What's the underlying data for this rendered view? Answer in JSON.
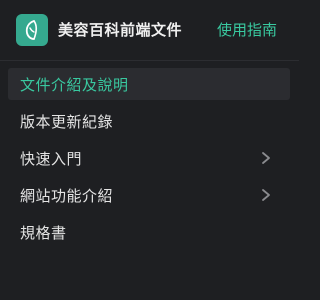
{
  "header": {
    "title": "美容百科前端文件",
    "guide_label": "使用指南",
    "logo_icon": "leaf-face-logo-icon"
  },
  "nav": {
    "items": [
      {
        "label": "文件介紹及說明",
        "active": true,
        "has_children": false
      },
      {
        "label": "版本更新紀錄",
        "active": false,
        "has_children": false
      },
      {
        "label": "快速入門",
        "active": false,
        "has_children": true
      },
      {
        "label": "網站功能介紹",
        "active": false,
        "has_children": true
      },
      {
        "label": "規格書",
        "active": false,
        "has_children": false
      }
    ]
  },
  "colors": {
    "accent": "#39c9a0",
    "background": "#1e1f22",
    "active_bg": "#2b2c30",
    "logo_bg": "#35a98f"
  }
}
